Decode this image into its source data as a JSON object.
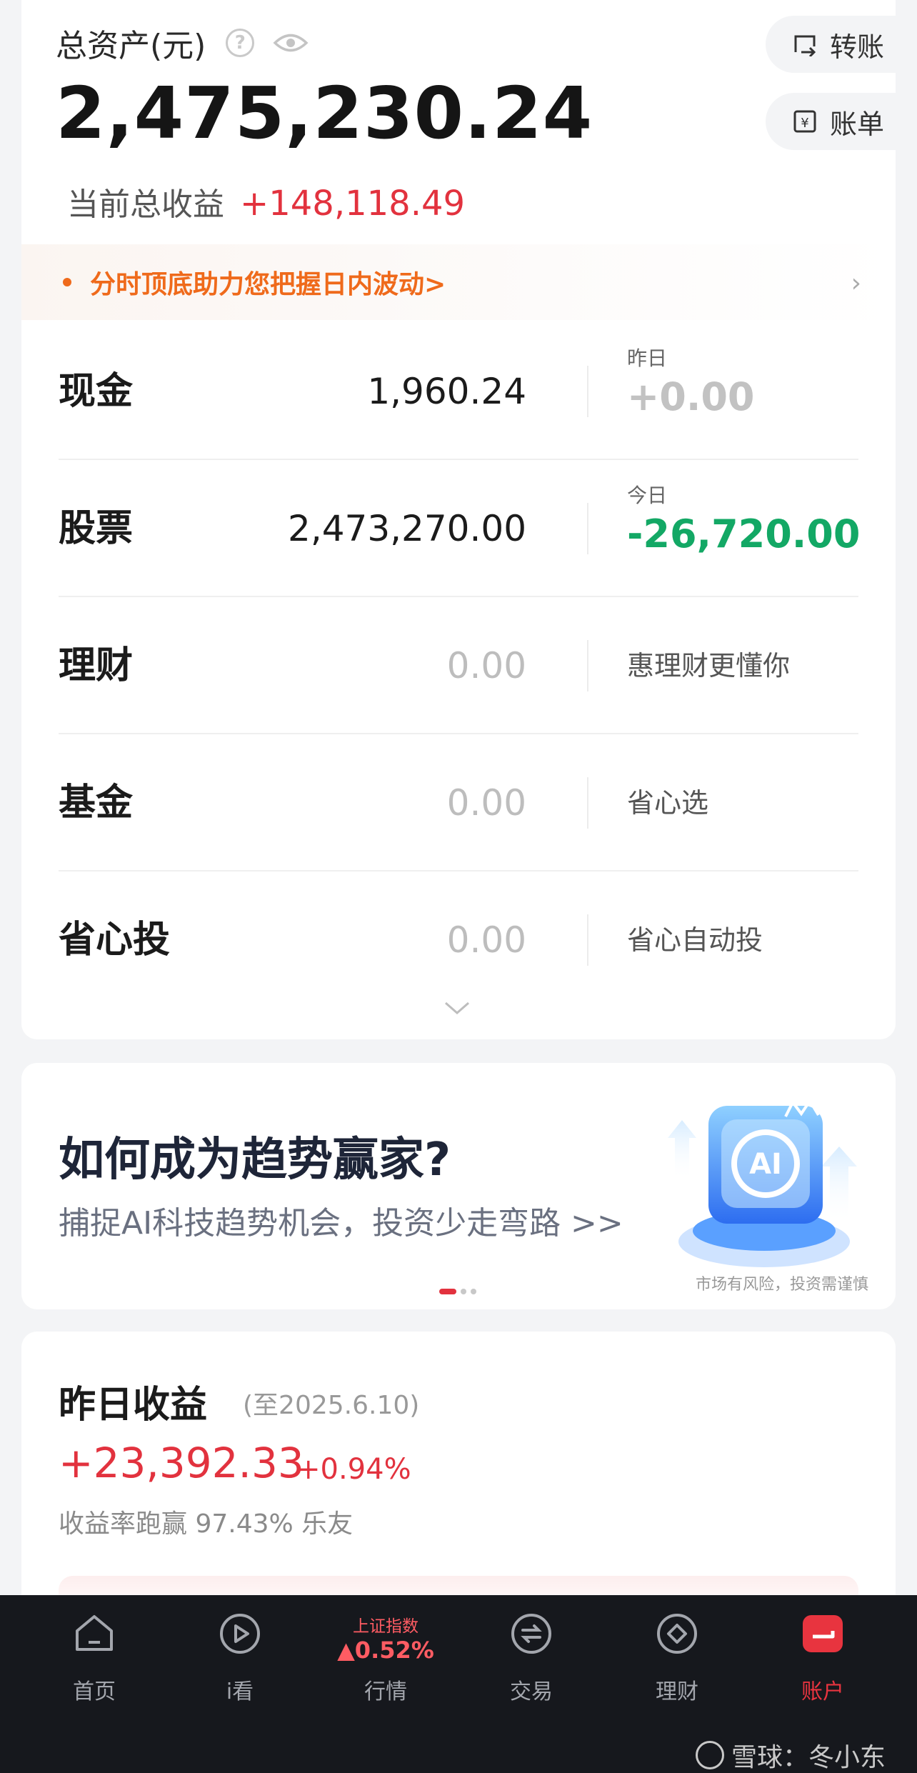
{
  "header": {
    "total_label": "总资产(元)",
    "total_value": "2,475,230.24",
    "profit_label": "当前总收益",
    "profit_value": "+148,118.49",
    "transfer_label": "转账",
    "bill_label": "账单"
  },
  "notice": {
    "text": "分时顶底助力您把握日内波动>"
  },
  "assets": [
    {
      "name": "现金",
      "amount": "1,960.24",
      "sub_label": "昨日",
      "change": "+0.00",
      "note": ""
    },
    {
      "name": "股票",
      "amount": "2,473,270.00",
      "sub_label": "今日",
      "change": "-26,720.00",
      "note": ""
    },
    {
      "name": "理财",
      "amount": "0.00",
      "sub_label": "",
      "change": "",
      "note": "惠理财更懂你"
    },
    {
      "name": "基金",
      "amount": "0.00",
      "sub_label": "",
      "change": "",
      "note": "省心选"
    },
    {
      "name": "省心投",
      "amount": "0.00",
      "sub_label": "",
      "change": "",
      "note": "省心自动投"
    }
  ],
  "promo": {
    "title": "如何成为趋势赢家?",
    "subtitle": "捕捉AI科技趋势机会，投资少走弯路 >>",
    "risk": "市场有风险，投资需谨慎",
    "art_label": "AI"
  },
  "yesterday": {
    "title": "昨日收益",
    "date": "(至2025.6.10)",
    "value": "+23,392.33",
    "percent": "+0.94%",
    "beat": "收益率跑赢 97.43% 乐友"
  },
  "tabbar": {
    "items": [
      {
        "label": "首页",
        "icon": "home-icon"
      },
      {
        "label": "i看",
        "icon": "play-icon"
      },
      {
        "label": "行情",
        "icon": "market-icon",
        "index_name": "上证指数",
        "index_change": "▲0.52%"
      },
      {
        "label": "交易",
        "icon": "trade-icon"
      },
      {
        "label": "理财",
        "icon": "wealth-icon"
      },
      {
        "label": "账户",
        "icon": "account-icon"
      }
    ],
    "active": "账户"
  },
  "watermark": "雪球：冬小东",
  "colors": {
    "up": "#e2323e",
    "down": "#13a865",
    "accent_orange": "#ef6a1b",
    "tabbar_bg": "#16181d"
  }
}
